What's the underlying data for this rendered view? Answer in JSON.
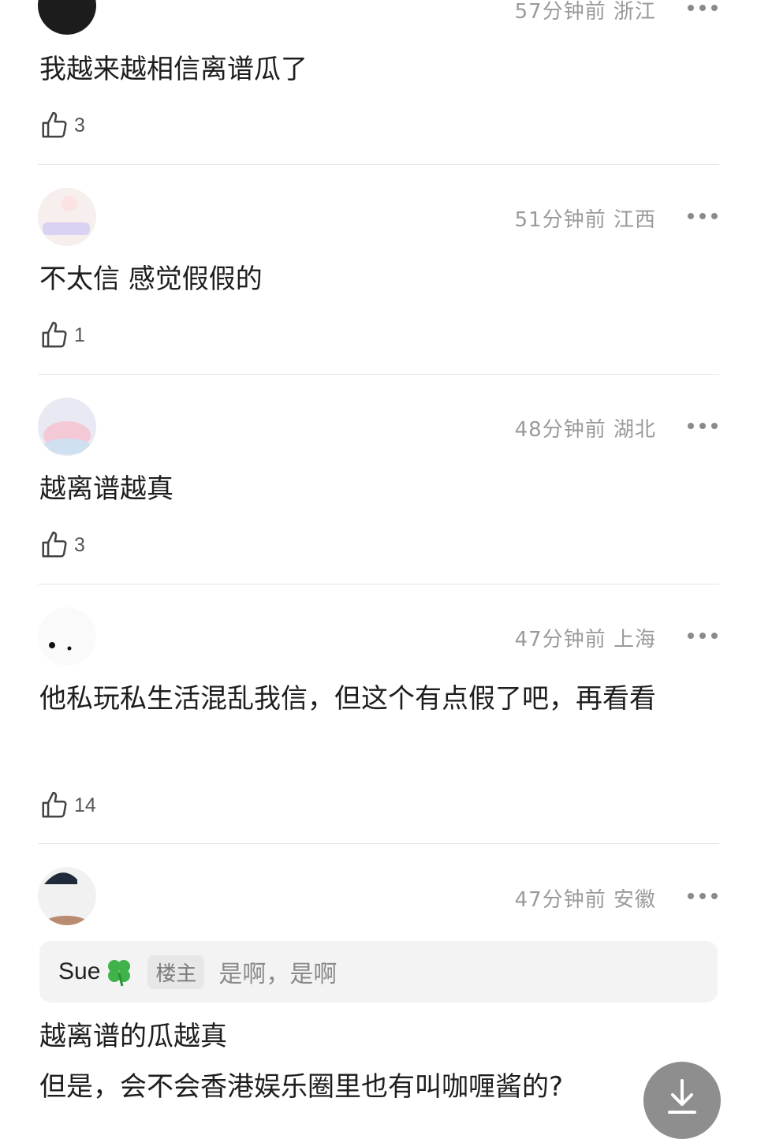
{
  "comments": [
    {
      "meta": "57分钟前 浙江",
      "text": "我越来越相信离谱瓜了",
      "likes": "3"
    },
    {
      "meta": "51分钟前 江西",
      "text": "不太信  感觉假假的",
      "likes": "1"
    },
    {
      "meta": "48分钟前 湖北",
      "text": "越离谱越真",
      "likes": "3"
    },
    {
      "meta": "47分钟前 上海",
      "text": "他私玩私生活混乱我信，但这个有点假了吧，再看看",
      "likes": "14"
    },
    {
      "meta": "47分钟前 安徽",
      "reply": {
        "name": "Sue",
        "badge": "楼主",
        "text": "是啊，是啊"
      },
      "text_line1": "越离谱的瓜越真",
      "text_line2": "但是，会不会香港娱乐圈里也有叫咖喱酱的?"
    }
  ],
  "icons": {
    "like": "thumbs-up-icon",
    "more": "more-dots-icon",
    "clover": "four-leaf-clover-icon",
    "download": "download-arrow-icon"
  },
  "colors": {
    "meta_text": "#9a9a9a",
    "divider": "#e6e6e6",
    "reply_bg": "#f3f3f3",
    "download_bg": "#8e8e8e"
  }
}
